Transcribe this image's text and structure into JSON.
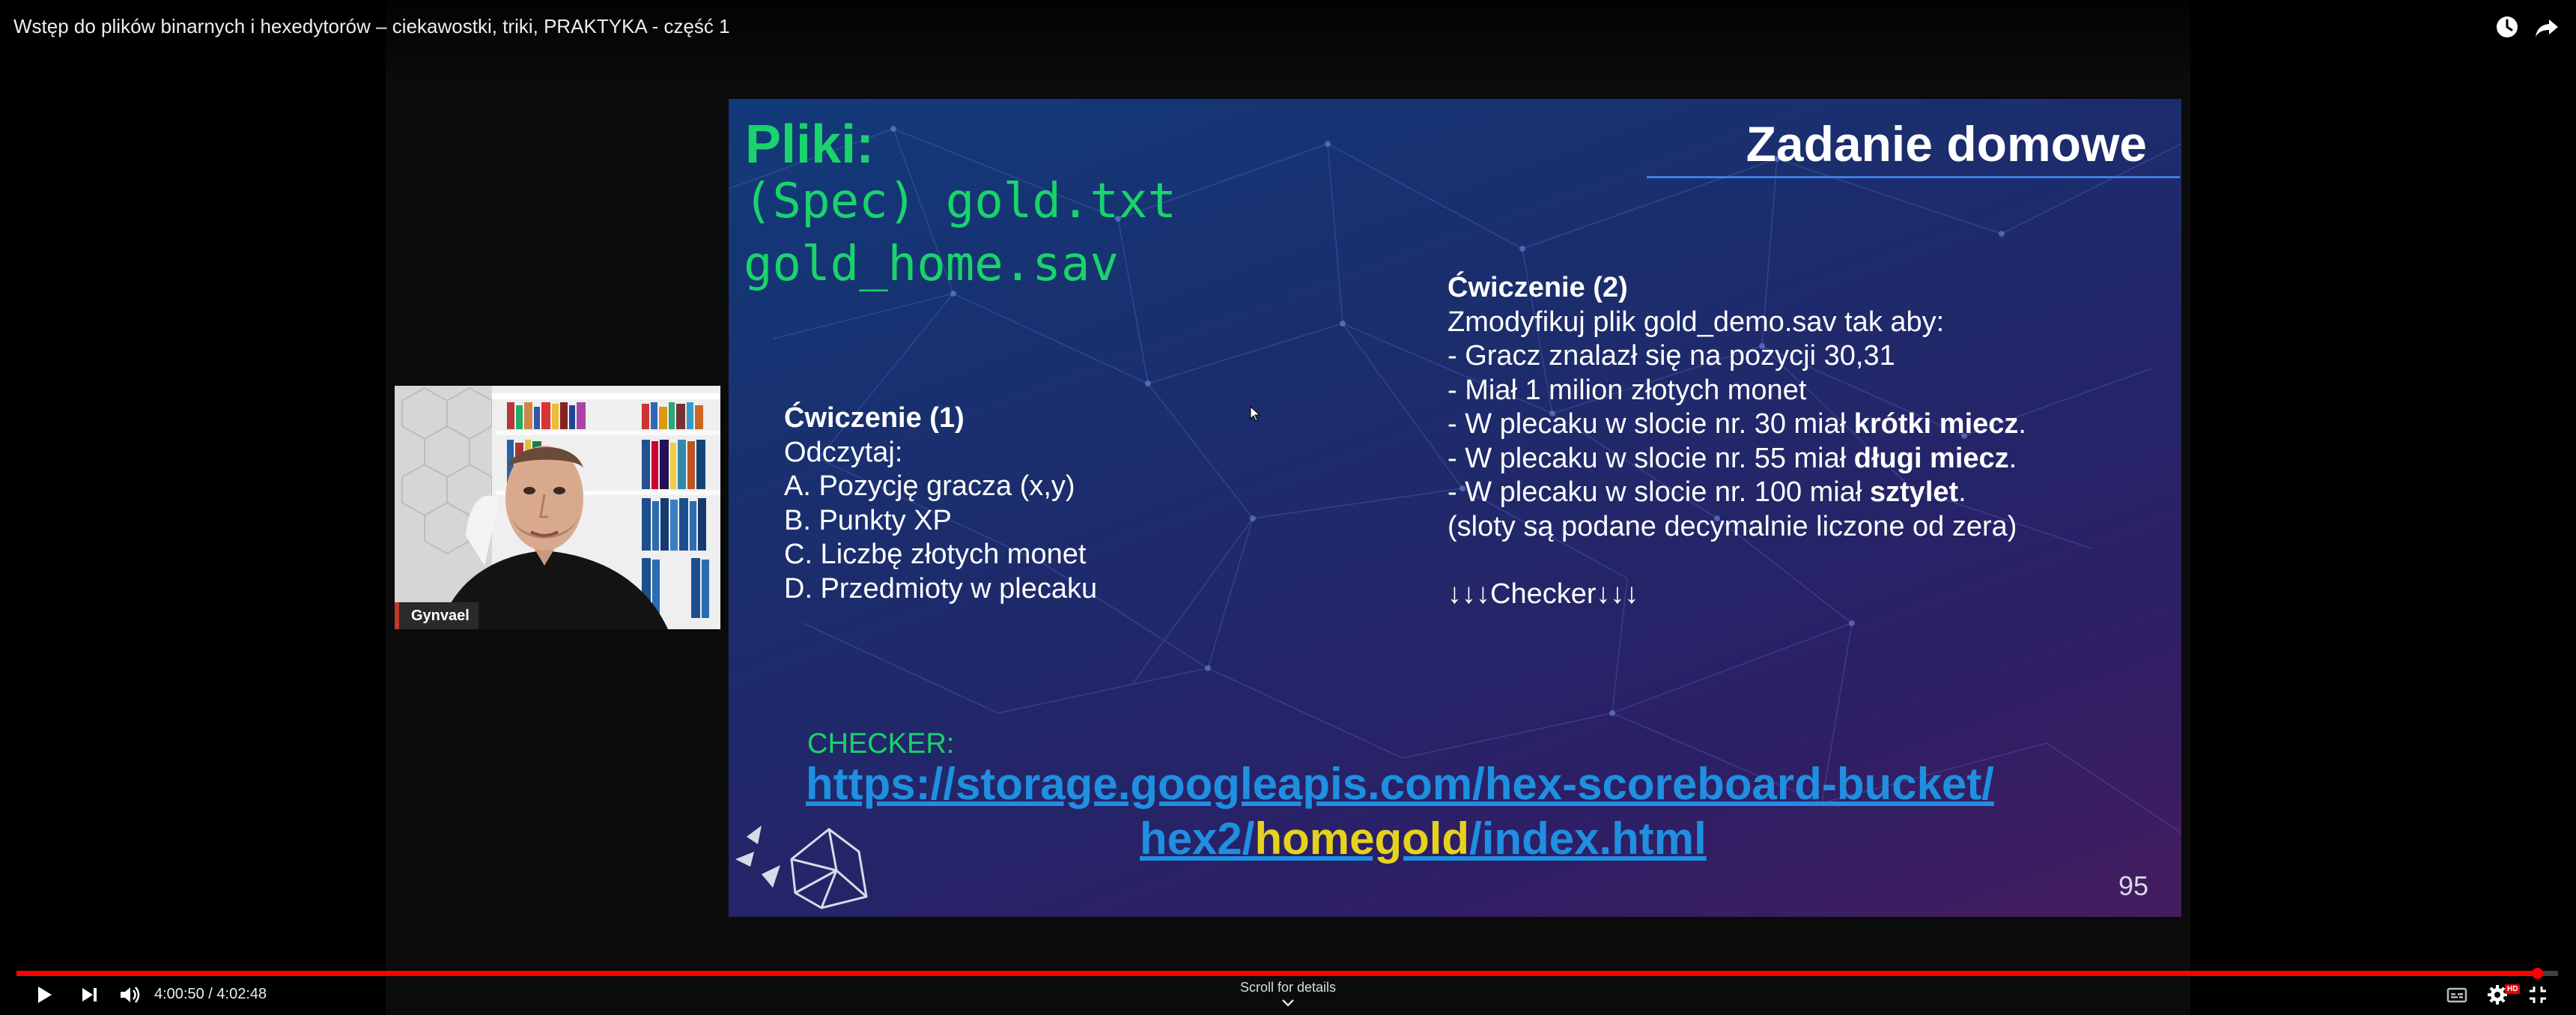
{
  "video": {
    "title": "Wstęp do plików binarnych i hexedytorów – ciekawostki, triki, PRAKTYKA - część 1"
  },
  "icons": {
    "top_right": [
      "watch-later-icon",
      "share-icon"
    ],
    "controls_left": [
      "play-icon",
      "next-icon",
      "volume-icon"
    ],
    "controls_right": [
      "subtitles-icon",
      "settings-icon",
      "exit-fullscreen-icon"
    ]
  },
  "webcam": {
    "name": "Gynvael"
  },
  "slide": {
    "title": "Zadanie domowe",
    "files_heading": "Pliki:",
    "files": [
      "(Spec) gold.txt",
      "gold_home.sav"
    ],
    "exercise1": {
      "title": "Ćwiczenie (1)",
      "lines": [
        "Odczytaj:",
        "A. Pozycję gracza (x,y)",
        "B. Punkty XP",
        "C. Liczbę złotych monet",
        "D. Przedmioty w plecaku"
      ]
    },
    "exercise2": {
      "title": "Ćwiczenie (2)",
      "line1": "Zmodyfikuj plik gold_demo.sav tak aby:",
      "line2": "- Gracz znalazł się na pozycji 30,31",
      "line3": "- Miał 1 milion złotych monet",
      "line4_pre": "- W plecaku w slocie nr. 30 miał ",
      "line4_bold": "krótki miecz",
      "line4_post": ".",
      "line5_pre": "- W plecaku w slocie nr. 55 miał ",
      "line5_bold": "długi miecz",
      "line5_post": ".",
      "line6_pre": "- W plecaku w slocie nr. 100 miał ",
      "line6_bold": "sztylet",
      "line6_post": ".",
      "line7": "(sloty są podane decymalnie liczone od zera)",
      "checker_arrows": "↓↓↓Checker↓↓↓"
    },
    "checker_label": "CHECKER:",
    "url_line1": "https://storage.googleapis.com/hex-scoreboard-bucket/",
    "url_line2_pre": "hex2/",
    "url_line2_highlight": "homegold",
    "url_line2_post": "/index.html",
    "slide_number": "95",
    "colors": {
      "heading_green": "#19d36b",
      "link_blue": "#1f8fe0",
      "highlight_yellow": "#e6d21c",
      "accent_line": "#3d7fe0"
    }
  },
  "controls": {
    "current_time": "4:00:50",
    "separator": " / ",
    "duration": "4:02:48",
    "progress_fraction": 0.9917,
    "progress_color": "#ff0000",
    "scroll_hint": "Scroll for details",
    "hd_badge": "HD"
  }
}
